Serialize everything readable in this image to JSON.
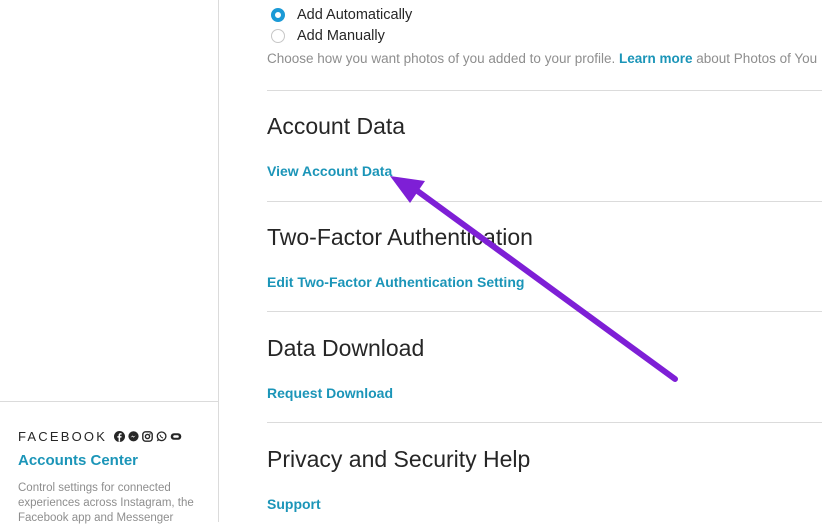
{
  "sidebar": {
    "brand": "FACEBOOK",
    "brand_icons": [
      "facebook-icon",
      "messenger-icon",
      "instagram-icon",
      "whatsapp-icon",
      "portal-icon"
    ],
    "accounts_center_link": "Accounts Center",
    "description": "Control settings for connected experiences across Instagram, the Facebook app and Messenger"
  },
  "photos_of_you": {
    "options": [
      {
        "label": "Add Automatically",
        "selected": true
      },
      {
        "label": "Add Manually",
        "selected": false
      }
    ],
    "hint_prefix": "Choose how you want photos of you added to your profile. ",
    "learn_more": "Learn more",
    "hint_suffix": " about Photos of You"
  },
  "sections": [
    {
      "title": "Account Data",
      "link": "View Account Data"
    },
    {
      "title": "Two-Factor Authentication",
      "link": "Edit Two-Factor Authentication Setting"
    },
    {
      "title": "Data Download",
      "link": "Request Download"
    },
    {
      "title": "Privacy and Security Help",
      "link": "Support"
    }
  ],
  "colors": {
    "accent_link": "#1b95b8",
    "radio_selected": "#1b9ad6",
    "annotation_arrow": "#7e1fd6",
    "divider": "#dbdbdb"
  }
}
